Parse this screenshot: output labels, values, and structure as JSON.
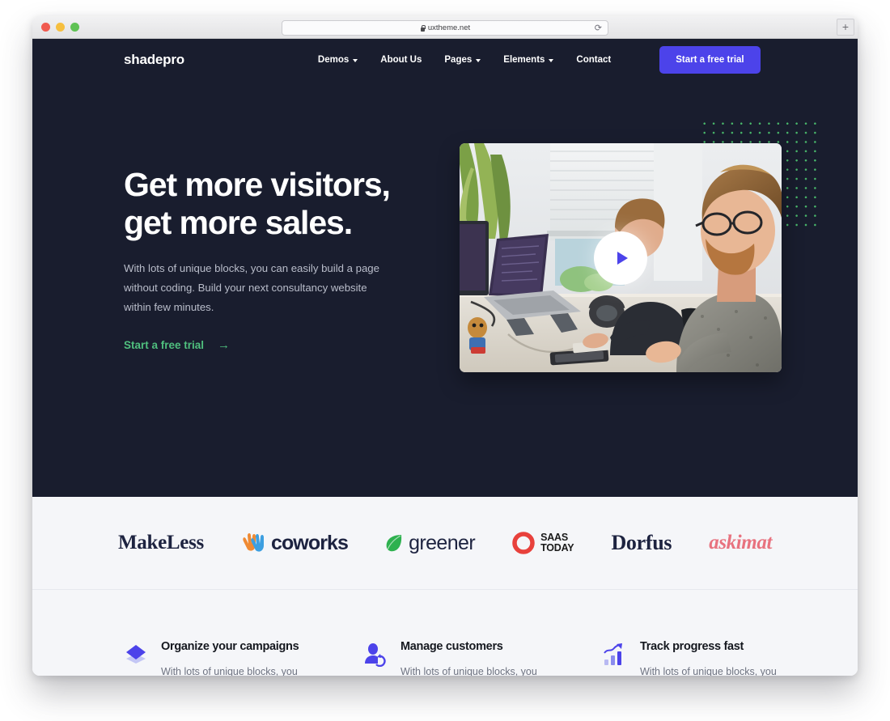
{
  "browser": {
    "url": "uxtheme.net",
    "lock_icon": "lock-icon",
    "reload_icon": "reload-icon",
    "newtab_label": "+",
    "traffic_lights": [
      "close-red",
      "minimize-yellow",
      "zoom-green"
    ]
  },
  "site": {
    "brand": "shadepro",
    "nav": {
      "items": [
        {
          "label": "Demos",
          "has_caret": true
        },
        {
          "label": "About Us",
          "has_caret": false
        },
        {
          "label": "Pages",
          "has_caret": true
        },
        {
          "label": "Elements",
          "has_caret": true
        },
        {
          "label": "Contact",
          "has_caret": false
        }
      ],
      "cta_label": "Start a free trial"
    },
    "hero": {
      "heading": "Get more visitors,\nget more sales.",
      "subtext": "With lots of unique blocks, you can easily build a page without coding. Build your next consultancy website within few minutes.",
      "cta_label": "Start a free trial",
      "cta_arrow": "→",
      "play_icon": "play-icon",
      "decoration": "dot-grid-pattern"
    },
    "clients": [
      {
        "name": "MakeLess",
        "icon": null
      },
      {
        "name": "coworks",
        "icon": "waving-hands-icon"
      },
      {
        "name": "greener",
        "icon": "leaf-icon"
      },
      {
        "name": "SAAS\nTODAY",
        "icon": "red-ring-icon"
      },
      {
        "name": "Dorfus",
        "icon": null
      },
      {
        "name": "askimat",
        "icon": null
      }
    ],
    "features": [
      {
        "icon": "layers-diamond-icon",
        "title": "Organize your campaigns",
        "desc": "With lots of unique blocks, you can easily build a page without coding."
      },
      {
        "icon": "customer-sync-icon",
        "title": "Manage customers",
        "desc": "With lots of unique blocks, you can easily build a page without coding."
      },
      {
        "icon": "bar-chart-trend-icon",
        "title": "Track progress fast",
        "desc": "With lots of unique blocks, you can easily build a page without coding."
      }
    ]
  },
  "colors": {
    "hero_bg": "#191d2e",
    "accent_indigo": "#4c43ea",
    "accent_green": "#4fbf7e",
    "dot_green": "#49b96b",
    "strip_bg": "#f5f6f9",
    "pink": "#e8727f",
    "red_ring": "#e8413c"
  }
}
